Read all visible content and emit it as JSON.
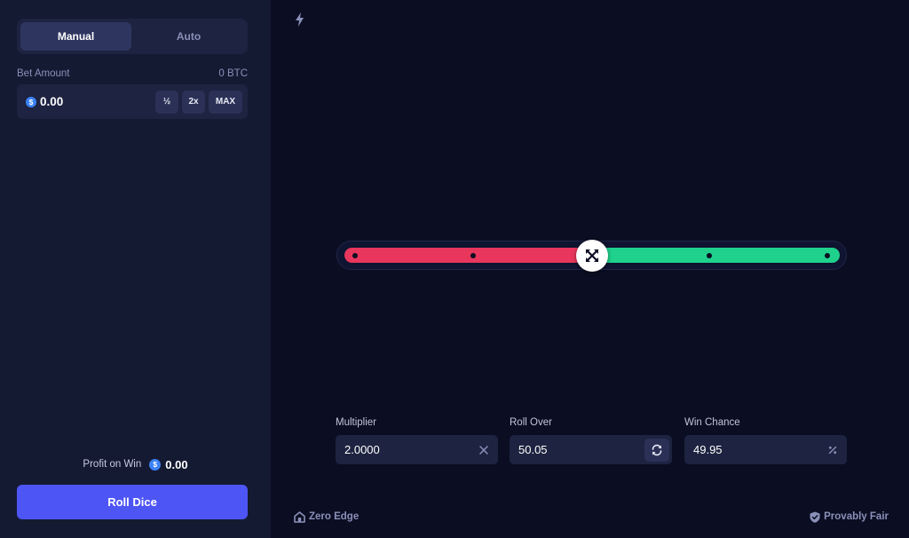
{
  "sidebar": {
    "mode_tabs": {
      "manual": "Manual",
      "auto": "Auto",
      "active": "Manual"
    },
    "bet_amount": {
      "label": "Bet Amount",
      "crypto_value": "0 BTC",
      "currency_symbol": "$",
      "value": "0.00",
      "half_label": "½",
      "double_label": "2x",
      "max_label": "MAX"
    },
    "profit_on_win": {
      "label": "Profit on Win",
      "currency_symbol": "$",
      "value": "0.00"
    },
    "roll_button_label": "Roll Dice"
  },
  "slider": {
    "roll_over": 50.05,
    "lose_color": "#e8365d",
    "win_color": "#1fd18c",
    "handle_icon": "crossed-arrows-icon"
  },
  "stats": {
    "multiplier": {
      "label": "Multiplier",
      "value": "2.0000",
      "icon": "close-icon"
    },
    "roll_over": {
      "label": "Roll Over",
      "value": "50.05",
      "icon": "refresh-icon"
    },
    "win_chance": {
      "label": "Win Chance",
      "value": "49.95",
      "icon": "percent-icon"
    }
  },
  "footer": {
    "left_label": "Zero Edge",
    "left_icon": "house-icon",
    "right_label": "Provably Fair",
    "right_icon": "shield-check-icon"
  },
  "header": {
    "icon": "lightning-icon"
  },
  "colors": {
    "accent": "#4d55f5",
    "coin": "#3b82f6"
  }
}
